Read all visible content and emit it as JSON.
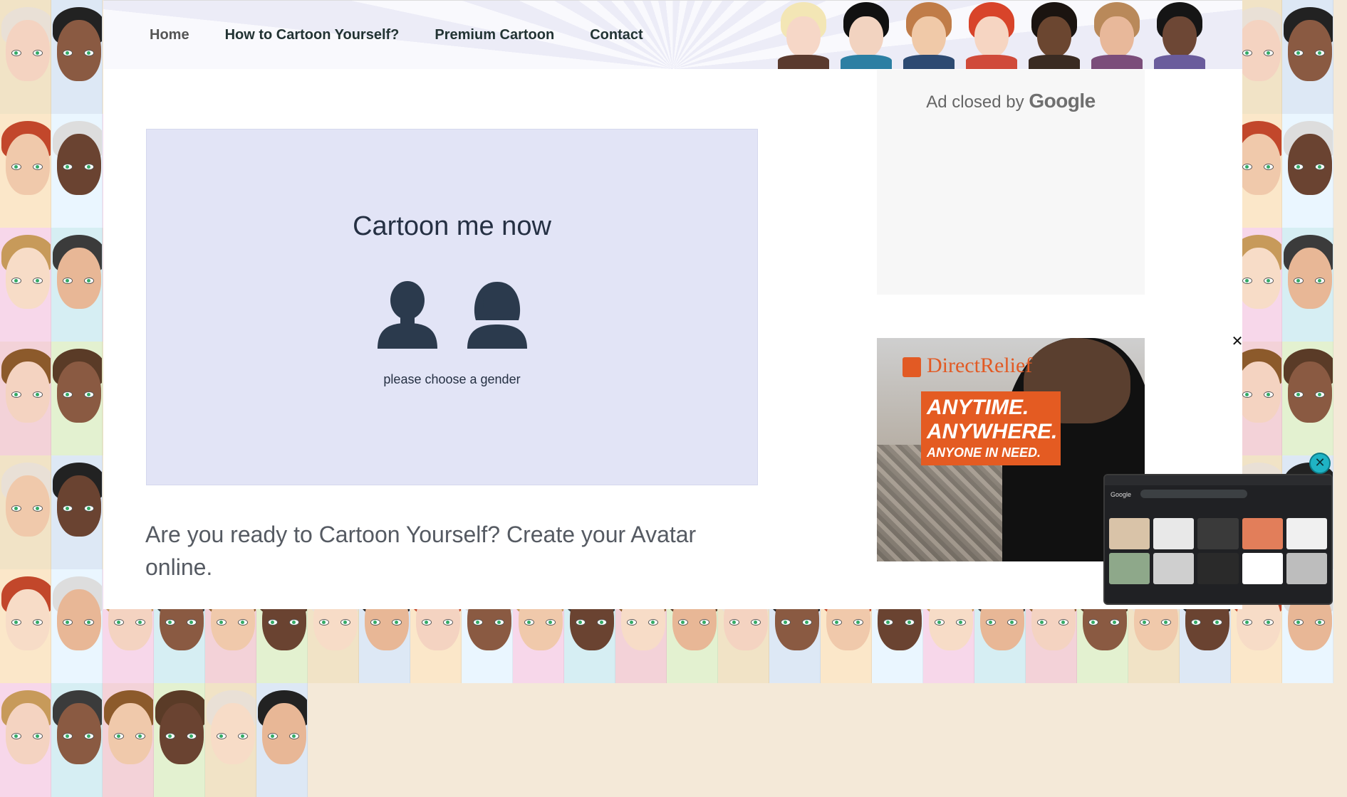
{
  "nav": {
    "items": [
      {
        "label": "Home"
      },
      {
        "label": "How to Cartoon Yourself?"
      },
      {
        "label": "Premium Cartoon"
      },
      {
        "label": "Contact"
      }
    ]
  },
  "cta": {
    "title": "Cartoon me now",
    "hint": "please choose a gender",
    "male_icon": "male-silhouette-icon",
    "female_icon": "female-silhouette-icon"
  },
  "intro": {
    "text": "Are you ready to Cartoon Yourself? Create your Avatar online."
  },
  "ad_closed": {
    "prefix": "Ad closed by",
    "brand": "Google"
  },
  "ad_banner": {
    "brand": "DirectRelief",
    "line1": "ANYTIME.",
    "line2": "ANYWHERE.",
    "line3": "ANYONE IN NEED.",
    "close_icon": "close-icon"
  },
  "pip": {
    "google_label": "Google",
    "close_icon": "close-circle-icon"
  },
  "colors": {
    "cta_background": "#e2e4f6",
    "text_dark": "#253043",
    "ad_orange": "#e45b22",
    "pip_close": "#1fb3c4"
  }
}
